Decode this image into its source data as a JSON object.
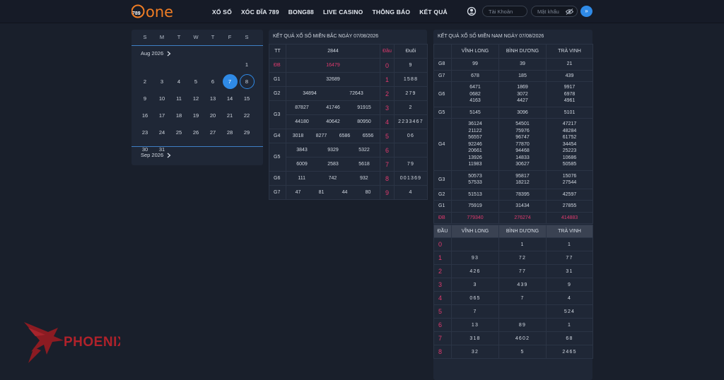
{
  "header": {
    "logo_number": "789",
    "logo_word": "one",
    "nav": [
      "XỔ SỐ",
      "XÓC ĐĨA 789",
      "BONG88",
      "LIVE CASINO",
      "THÔNG BÁO",
      "KẾT QUẢ"
    ],
    "username_placeholder": "Tài Khoản",
    "password_placeholder": "Mật khẩu",
    "login_glyph": "»"
  },
  "calendar": {
    "weekdays": [
      "S",
      "M",
      "T",
      "W",
      "T",
      "F",
      "S"
    ],
    "month_label": "Aug 2026",
    "next_month_label": "Sep 2026",
    "weeks": [
      [
        "",
        "",
        "",
        "",
        "",
        "",
        "1"
      ],
      [
        "2",
        "3",
        "4",
        "5",
        "6",
        "7",
        "8"
      ],
      [
        "9",
        "10",
        "11",
        "12",
        "13",
        "14",
        "15"
      ],
      [
        "16",
        "17",
        "18",
        "19",
        "20",
        "21",
        "22"
      ],
      [
        "23",
        "24",
        "25",
        "26",
        "27",
        "28",
        "29"
      ],
      [
        "30",
        "31",
        "",
        "",
        "",
        "",
        ""
      ]
    ],
    "selected_day": "7",
    "today_day": "8"
  },
  "north": {
    "title": "KẾT QUẢ XỔ SỐ MIỀN BẮC NGÀY 07/08/2026",
    "headers": [
      "TT",
      "2844",
      "Đầu",
      "Đuôi"
    ],
    "rows": [
      {
        "label": "ĐB",
        "lines": [
          [
            "16479"
          ]
        ],
        "red": true
      },
      {
        "label": "G1",
        "lines": [
          [
            "32689"
          ]
        ]
      },
      {
        "label": "G2",
        "lines": [
          [
            "34894",
            "72643"
          ]
        ]
      },
      {
        "label": "G3",
        "lines": [
          [
            "87827",
            "41746",
            "91915"
          ],
          [
            "44180",
            "40642",
            "80950"
          ]
        ]
      },
      {
        "label": "G4",
        "lines": [
          [
            "3018",
            "8277",
            "6586",
            "6556"
          ]
        ]
      },
      {
        "label": "G5",
        "lines": [
          [
            "3843",
            "9329",
            "5322"
          ],
          [
            "6009",
            "2583",
            "5618"
          ]
        ]
      },
      {
        "label": "G6",
        "lines": [
          [
            "111",
            "742",
            "932"
          ]
        ]
      },
      {
        "label": "G7",
        "lines": [
          [
            "47",
            "81",
            "44",
            "80"
          ]
        ]
      }
    ],
    "dau_duoi": [
      [
        "0",
        "9"
      ],
      [
        "1",
        "1588"
      ],
      [
        "2",
        "279"
      ],
      [
        "3",
        "2"
      ],
      [
        "4",
        "2233467"
      ],
      [
        "5",
        "06"
      ],
      [
        "6",
        ""
      ],
      [
        "7",
        "79"
      ],
      [
        "8",
        "001369"
      ],
      [
        "9",
        "4"
      ]
    ]
  },
  "south": {
    "title": "KẾT QUẢ XỔ SỐ MIỀN NAM NGÀY 07/08/2026",
    "provinces": [
      "VĨNH LONG",
      "BÌNH DƯƠNG",
      "TRÀ VINH"
    ],
    "prizes": [
      {
        "label": "G8",
        "cols": [
          [
            "99"
          ],
          [
            "39"
          ],
          [
            "21"
          ]
        ]
      },
      {
        "label": "G7",
        "cols": [
          [
            "678"
          ],
          [
            "185"
          ],
          [
            "439"
          ]
        ]
      },
      {
        "label": "G6",
        "cols": [
          [
            "6471",
            "0682",
            "4163"
          ],
          [
            "1869",
            "3072",
            "4427"
          ],
          [
            "9917",
            "6978",
            "4961"
          ]
        ]
      },
      {
        "label": "G5",
        "cols": [
          [
            "5145"
          ],
          [
            "3096"
          ],
          [
            "5101"
          ]
        ]
      },
      {
        "label": "G4",
        "cols": [
          [
            "36124",
            "21122",
            "56557",
            "92246",
            "20661",
            "13926",
            "11983"
          ],
          [
            "54501",
            "75976",
            "96747",
            "77870",
            "94468",
            "14833",
            "30627"
          ],
          [
            "47217",
            "48284",
            "61752",
            "34454",
            "25223",
            "10686",
            "50585"
          ]
        ]
      },
      {
        "label": "G3",
        "cols": [
          [
            "50573",
            "57533"
          ],
          [
            "95817",
            "18212"
          ],
          [
            "15076",
            "27544"
          ]
        ]
      },
      {
        "label": "G2",
        "cols": [
          [
            "51513"
          ],
          [
            "78395"
          ],
          [
            "42597"
          ]
        ]
      },
      {
        "label": "G1",
        "cols": [
          [
            "75919"
          ],
          [
            "31434"
          ],
          [
            "27855"
          ]
        ]
      },
      {
        "label": "ĐB",
        "cols": [
          [
            "779340"
          ],
          [
            "276274"
          ],
          [
            "414883"
          ]
        ],
        "red": true
      }
    ],
    "dau_header": "ĐẦU",
    "dau_provinces": [
      "VĨNH LONG",
      "BÌNH DƯƠNG",
      "TRÀ VINH"
    ],
    "dau_rows": [
      [
        "0",
        "",
        "1",
        "1"
      ],
      [
        "1",
        "93",
        "72",
        "77"
      ],
      [
        "2",
        "426",
        "77",
        "31"
      ],
      [
        "3",
        "3",
        "439",
        "9"
      ],
      [
        "4",
        "065",
        "7",
        "4"
      ],
      [
        "5",
        "7",
        "",
        "524"
      ],
      [
        "6",
        "13",
        "89",
        "1"
      ],
      [
        "7",
        "318",
        "4602",
        "68"
      ],
      [
        "8",
        "32",
        "5",
        "2465"
      ]
    ]
  },
  "watermark": {
    "text": "PHOENIX"
  },
  "colors": {
    "accent": "#2f8ae6",
    "red": "#e03a6e",
    "logo_orange": "#f07d24",
    "panel": "#1f2736"
  }
}
